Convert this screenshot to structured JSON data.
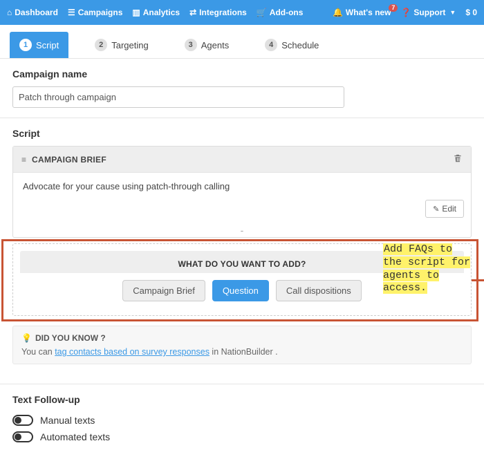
{
  "nav": {
    "dashboard": "Dashboard",
    "campaigns": "Campaigns",
    "analytics": "Analytics",
    "integrations": "Integrations",
    "addons": "Add-ons",
    "whats_new": "What's new",
    "whats_new_badge": "7",
    "support": "Support",
    "balance": "$ 0"
  },
  "tabs": [
    {
      "num": "1",
      "label": "Script"
    },
    {
      "num": "2",
      "label": "Targeting"
    },
    {
      "num": "3",
      "label": "Agents"
    },
    {
      "num": "4",
      "label": "Schedule"
    }
  ],
  "campaign_name": {
    "label": "Campaign name",
    "value": "Patch through campaign"
  },
  "script": {
    "heading": "Script",
    "block_title": "CAMPAIGN BRIEF",
    "block_body": "Advocate for your cause using patch-through calling",
    "edit_label": "Edit",
    "divider": "-"
  },
  "add_panel": {
    "title": "WHAT DO YOU WANT TO ADD?",
    "buttons": {
      "brief": "Campaign Brief",
      "question": "Question",
      "dispositions": "Call dispositions"
    }
  },
  "dyk": {
    "title": "DID YOU KNOW ?",
    "prefix": "You can ",
    "link": "tag contacts based on survey responses",
    "suffix": " in NationBuilder ."
  },
  "followup": {
    "heading": "Text Follow-up",
    "manual": "Manual texts",
    "automated": "Automated texts"
  },
  "annotation": "Add FAQs to the script for agents to access."
}
